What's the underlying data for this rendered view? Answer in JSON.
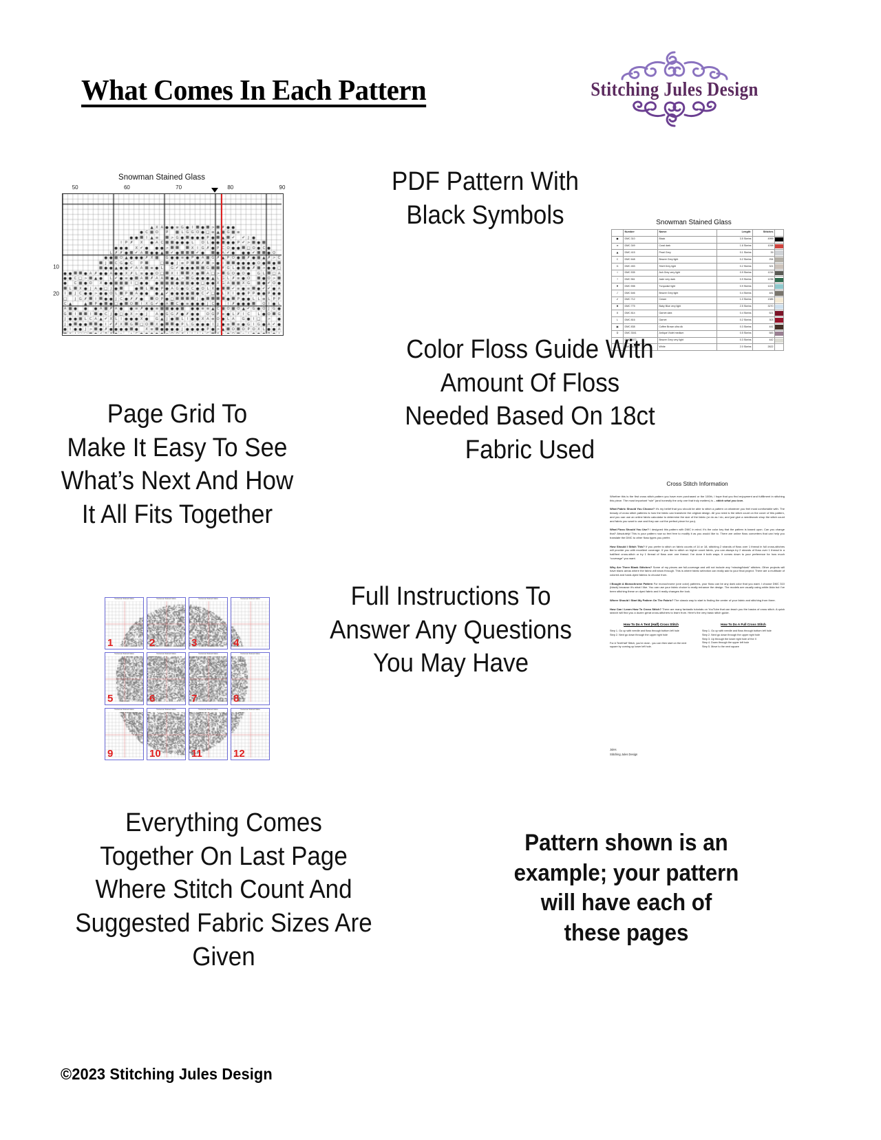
{
  "header": {
    "title": "What Comes In Each Pattern",
    "logo_text": "Stitching Jules Design"
  },
  "copy": {
    "pdf_pattern": "PDF Pattern With\nBlack Symbols",
    "page_grid": "Page Grid To\nMake It Easy To See\nWhat’s Next And How\nIt All Fits Together",
    "floss_guide": "Color Floss Guide With\nAmount Of Floss\nNeeded Based On 18ct\nFabric Used",
    "instructions": "Full Instructions To\nAnswer Any Questions\nYou May Have",
    "last_page": "Everything Comes\nTogether On Last Page\nWhere Stitch Count And\nSuggested Fabric Sizes Are\nGiven",
    "example_note": "Pattern shown is an\nexample; your pattern\nwill have each of\nthese pages"
  },
  "footer": {
    "copyright": "©2023 Stitching Jules Design"
  },
  "chart_thumbnail": {
    "title": "Snowman Stained Glass",
    "column_ticks": [
      "50",
      "60",
      "70",
      "80",
      "90"
    ],
    "row_ticks": [
      "10",
      "20"
    ],
    "center_line_color": "#e02020"
  },
  "floss_guide": {
    "title": "Snowman Stained Glass",
    "columns": [
      "",
      "Number",
      "Name:",
      "Length:",
      "Stitches"
    ],
    "rows": [
      {
        "symbol": "●",
        "number": "DMC   310",
        "name": "Black",
        "length": "3.5 Skeins",
        "stitches": "4999",
        "color": "#000000"
      },
      {
        "symbol": "≡",
        "number": "DMC   349",
        "name": "Coral dark",
        "length": "1.6 Skeins",
        "stitches": "1098",
        "color": "#d0453f"
      },
      {
        "symbol": "▲",
        "number": "DMC   415",
        "name": "Pearl Grey",
        "length": "0.1 Skeins",
        "stitches": "39",
        "color": "#cfd2d6"
      },
      {
        "symbol": "C",
        "number": "DMC   648",
        "name": "Beaver Grey light",
        "length": "0.2 Skeins",
        "stitches": "254",
        "color": "#b3afa7"
      },
      {
        "symbol": "G",
        "number": "DMC   453",
        "name": "Shell Grey light",
        "length": "0.2 Skeins",
        "stitches": "321",
        "color": "#cbc2ba"
      },
      {
        "symbol": "I",
        "number": "DMC   535",
        "name": "Ash Grey very light",
        "length": "0.9 Skeins",
        "stitches": "1216",
        "color": "#5a5a54"
      },
      {
        "symbol": "ℐ",
        "number": "DMC   561",
        "name": "Jade very dark",
        "length": "0.9 Skeins",
        "stitches": "1236",
        "color": "#2f6b4f"
      },
      {
        "symbol": "♦",
        "number": "DMC   598",
        "name": "Turquoise light",
        "length": "0.9 Skeins",
        "stitches": "1221",
        "color": "#8fc9cd"
      },
      {
        "symbol": "♪",
        "number": "DMC   646",
        "name": "Beaver Grey light",
        "length": "0.4 Skeins",
        "stitches": "481",
        "color": "#78746c"
      },
      {
        "symbol": "✔",
        "number": "DMC   712",
        "name": "Cream",
        "length": "1.0 Skeins",
        "stitches": "1385",
        "color": "#f3ead6"
      },
      {
        "symbol": "✖",
        "number": "DMC   775",
        "name": "Baby Blue very light",
        "length": "2.5 Skeins",
        "stitches": "3270",
        "color": "#cfe0ee"
      },
      {
        "symbol": "X",
        "number": "DMC   814",
        "name": "Garnet dark",
        "length": "0.4 Skeins",
        "stitches": "521",
        "color": "#7b1226"
      },
      {
        "symbol": "L",
        "number": "DMC   816",
        "name": "Garnet",
        "length": "0.2 Skeins",
        "stitches": "303",
        "color": "#97142b"
      },
      {
        "symbol": "▣",
        "number": "DMC   838",
        "name": "Coffee Brown ultra dk",
        "length": "0.3 Skeins",
        "stitches": "441",
        "color": "#453128"
      },
      {
        "symbol": "Ⅾ",
        "number": "DMC   3041",
        "name": "Antique Violet medium",
        "length": "0.5 Skeins",
        "stitches": "583",
        "color": "#9a7f92"
      },
      {
        "symbol": ">",
        "number": "DMC   3072",
        "name": "Beaver Grey very light",
        "length": "0.3 Skeins",
        "stitches": "442",
        "color": "#dcdcd4"
      },
      {
        "symbol": "△",
        "number": "DMC   BLANC",
        "name": "White",
        "length": "2.0 Skeins",
        "stitches": "2622",
        "color": "#ffffff"
      }
    ]
  },
  "page_grid": {
    "mini_title": "Snowman Stained Glass",
    "pages": [
      "1",
      "2",
      "3",
      "4",
      "5",
      "6",
      "7",
      "8",
      "9",
      "10",
      "11",
      "12"
    ]
  },
  "instructions_page": {
    "title": "Cross Stitch Information",
    "intro": "Whether this is the first cross stitch pattern you have ever purchased or the 100th, I hope that you find enjoyment and fulfillment in stitching this piece. The most important “rule” (and honestly the only one that truly matters) is – stitch what you love.",
    "intro_emphasis": "stitch what you love.",
    "paragraphs": [
      {
        "heading": "What Fabric Should You Choose?",
        "text": " It’s my belief that you should be able to stitch a pattern on whatever you feel most comfortable with. The beauty of cross stitch patterns is how the fabric can transform the original design.  All you need is the stitch count on the cover of this pattern, and you can use an online fabric calculator to determine the size of the fabric (or do as I do, and just give a needlework shop the stitch count and fabric you want to use and they can cut the perfect piece for you)."
      },
      {
        "heading": "What Floss Should You Use?",
        "text": " I designed this pattern with DMC in mind. It’s the color key that the pattern is based upon. Can you change that? Absolutely! This is your pattern now so feel free to modify it as you would like to.  There are online floss converters that can help you translate the DMC to other floss types you prefer."
      },
      {
        "heading": "How Should I Stitch This?",
        "text": " If you prefer to stitch on fabric counts of 14 or 18, stitching 2 strands of floss over 1 thread in full cross-stitches will provide you with excellent coverage. If you like to stitch on higher count fabric, you can always try 2 strands of floss over 1 thread in a half/tent cross-stitch or try 1 thread of floss over one thread. I’ve done it both ways. It comes down to your preference for how much “coverage” you want."
      },
      {
        "heading": "Why Are There Blank Stitches?",
        "text": " Some of my pieces are full-coverage and will not include any “missing/blank” stitches. Other projects will have blank areas where the fabric will show through. This is where fabric selection can really add to your final project. There are a multitude of colored and hand-dyed fabrics to choose from."
      },
      {
        "heading": "I Bought A Monochrome Pattern",
        "text": " For monochrome (one color) patterns, your floss can be any dark color that you want. I choose DMC 310 (black) because it’s what I like. You can use your fabric choice to really enhance the design. The models are usually using white Aida but I’ve been stitching these on dyed fabric and it really changes the look."
      },
      {
        "heading": "Where Should I Start My Pattern On The Fabric?",
        "text": " The classic way to start is finding the center of your fabric and stitching from there."
      },
      {
        "heading": "How Can I Learn How To Cross Stitch?",
        "text": " There are many fantastic tutorials on YouTube that can teach you the basics of cross stitch. A quick search will find you a dozen great cross-stitchers to learn from. Here’s the very basic stitch guide."
      }
    ],
    "stitch_guides": [
      {
        "heading": "How To Do A Tent (Half) Cross Stitch",
        "steps": [
          "Step 1. Go up with needle and floss through bottom left hole",
          "Step 2. Next go down through the upper right hole"
        ],
        "note": "For A Tent/Half' Stitch, you're done - you can then start on the next square by coming up lower left hole."
      },
      {
        "heading": "How To Do A Full Cross Stitch",
        "steps": [
          "Step 1. Go up with needle and floss through bottom left hole",
          "Step 2. Next go down through the upper right hole",
          "Step 3. Up through the lower right hole of the X",
          "Step 4. Down through the upper left hole",
          "Step 5. Move to the next square"
        ],
        "note": ""
      }
    ],
    "signature": [
      "Jules",
      "Stitching Jules Design"
    ]
  }
}
